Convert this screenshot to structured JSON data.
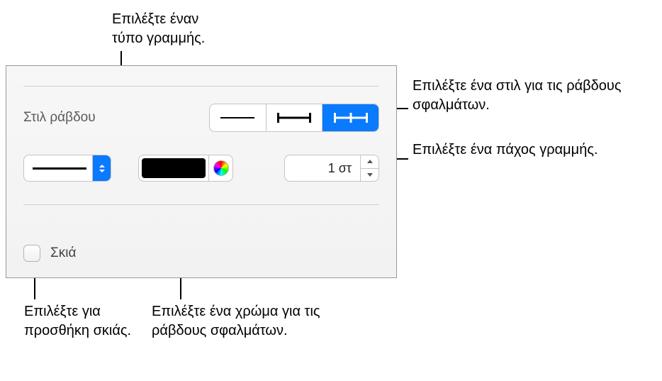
{
  "callouts": {
    "line_type": "Επιλέξτε έναν\nτύπο γραμμής.",
    "bar_style": "Επιλέξτε ένα στιλ για τις ράβδους σφαλμάτων.",
    "thickness": "Επιλέξτε ένα πάχος γραμμής.",
    "shadow": "Επιλέξτε για προσθήκη σκιάς.",
    "color": "Επιλέξτε ένα χρώμα για τις ράβδους σφαλμάτων."
  },
  "panel": {
    "title": "Στιλ ράβδου",
    "thickness_value": "1 στ",
    "shadow_label": "Σκιά"
  }
}
